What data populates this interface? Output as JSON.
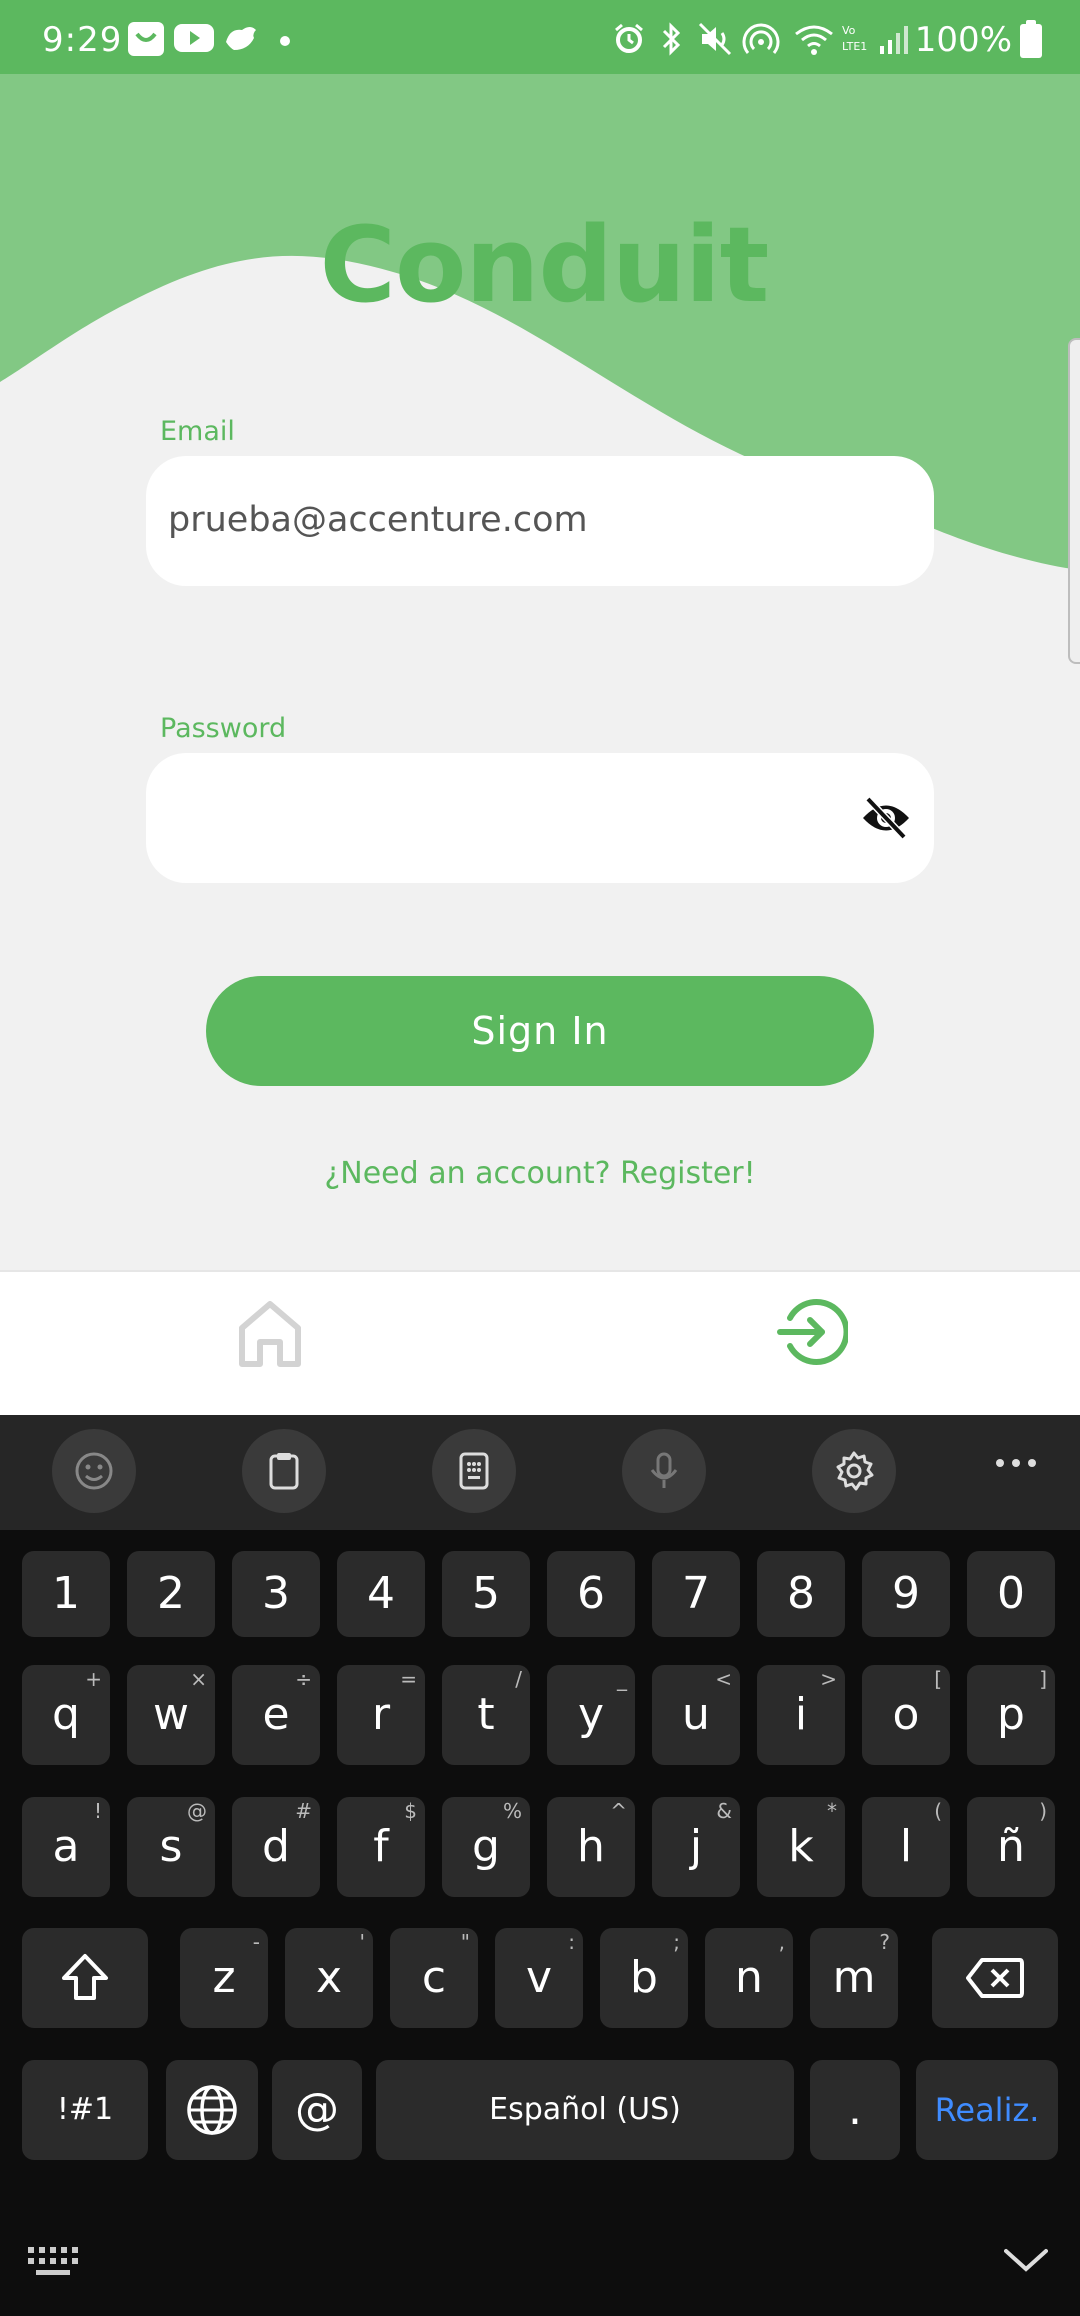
{
  "status_bar": {
    "time": "9:29",
    "battery": "100%",
    "icons": [
      "app-icon",
      "youtube-icon",
      "bird-icon",
      "dot-icon",
      "alarm-icon",
      "bluetooth-icon",
      "mute-icon",
      "hotspot-icon",
      "wifi-icon",
      "volte-icon",
      "signal-icon",
      "battery-icon"
    ]
  },
  "app": {
    "title": "Conduit",
    "email": {
      "label": "Email",
      "value": "prueba@accenture.com"
    },
    "password": {
      "label": "Password",
      "value": "",
      "toggle_icon": "eye-off-icon"
    },
    "sign_in_label": "Sign In",
    "register_link": "¿Need an account? Register!",
    "colors": {
      "brand": "#5cb85f",
      "wave": "#82c884",
      "background": "#f1f1f1"
    }
  },
  "bottom_nav": {
    "items": [
      {
        "icon": "home-icon",
        "active": false
      },
      {
        "icon": "login-icon",
        "active": true
      }
    ]
  },
  "keyboard": {
    "toolbar": [
      "emoji-icon",
      "clipboard-icon",
      "keypad-icon",
      "mic-icon",
      "settings-icon",
      "more-icon"
    ],
    "row_numbers": [
      "1",
      "2",
      "3",
      "4",
      "5",
      "6",
      "7",
      "8",
      "9",
      "0"
    ],
    "row_q": [
      {
        "k": "q",
        "h": "+"
      },
      {
        "k": "w",
        "h": "×"
      },
      {
        "k": "e",
        "h": "÷"
      },
      {
        "k": "r",
        "h": "="
      },
      {
        "k": "t",
        "h": "/"
      },
      {
        "k": "y",
        "h": "_"
      },
      {
        "k": "u",
        "h": "<"
      },
      {
        "k": "i",
        "h": ">"
      },
      {
        "k": "o",
        "h": "["
      },
      {
        "k": "p",
        "h": "]"
      }
    ],
    "row_a": [
      {
        "k": "a",
        "h": "!"
      },
      {
        "k": "s",
        "h": "@"
      },
      {
        "k": "d",
        "h": "#"
      },
      {
        "k": "f",
        "h": "$"
      },
      {
        "k": "g",
        "h": "%"
      },
      {
        "k": "h",
        "h": "^"
      },
      {
        "k": "j",
        "h": "&"
      },
      {
        "k": "k",
        "h": "*"
      },
      {
        "k": "l",
        "h": "("
      },
      {
        "k": "ñ",
        "h": ")"
      }
    ],
    "row_z": [
      {
        "k": "z",
        "h": "-"
      },
      {
        "k": "x",
        "h": "'"
      },
      {
        "k": "c",
        "h": "\""
      },
      {
        "k": "v",
        "h": ":"
      },
      {
        "k": "b",
        "h": ";"
      },
      {
        "k": "n",
        "h": ","
      },
      {
        "k": "m",
        "h": "?"
      }
    ],
    "symbols_label": "!#1",
    "at_label": "@",
    "space_label": "Español (US)",
    "period_label": ".",
    "done_label": "Realiz."
  }
}
